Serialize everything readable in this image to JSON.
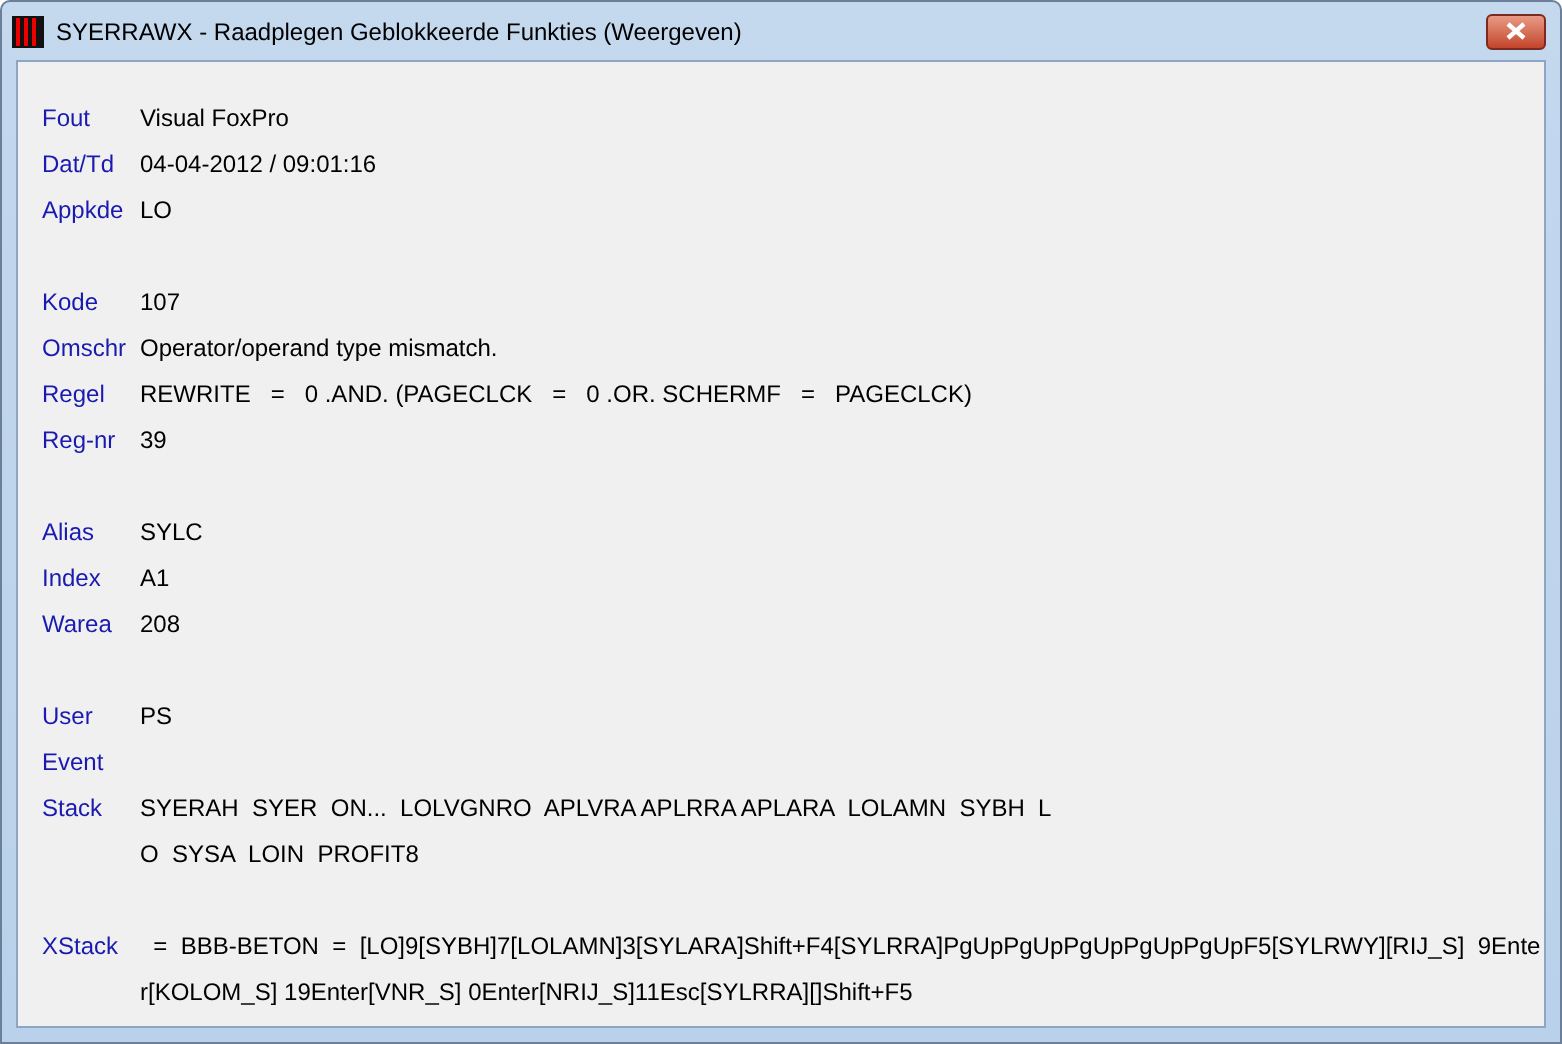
{
  "window": {
    "title": "SYERRAWX - Raadplegen Geblokkeerde Funkties (Weergeven)"
  },
  "groups": [
    {
      "fields": [
        {
          "label": "Fout",
          "lines": [
            "Visual FoxPro"
          ]
        },
        {
          "label": "Dat/Td",
          "lines": [
            "04-04-2012 / 09:01:16"
          ]
        },
        {
          "label": "Appkde",
          "lines": [
            "LO"
          ]
        }
      ]
    },
    {
      "fields": [
        {
          "label": "Kode",
          "lines": [
            "107"
          ]
        },
        {
          "label": "Omschr",
          "lines": [
            "Operator/operand type mismatch."
          ]
        },
        {
          "label": "Regel",
          "lines": [
            "REWRITE   =   0 .AND. (PAGECLCK   =   0 .OR. SCHERMF   =   PAGECLCK)"
          ]
        },
        {
          "label": "Reg-nr",
          "lines": [
            "39"
          ]
        }
      ]
    },
    {
      "fields": [
        {
          "label": "Alias",
          "lines": [
            "SYLC"
          ]
        },
        {
          "label": "Index",
          "lines": [
            "A1"
          ]
        },
        {
          "label": "Warea",
          "lines": [
            "208"
          ]
        }
      ]
    },
    {
      "fields": [
        {
          "label": "User",
          "lines": [
            "PS"
          ]
        },
        {
          "label": "Event"
        },
        {
          "label": "Stack",
          "lines": [
            "SYERAH  SYER  ON...  LOLVGNRO  APLVRA APLRRA APLARA  LOLAMN  SYBH  L",
            "O  SYSA  LOIN  PROFIT8"
          ]
        }
      ]
    },
    {
      "fields": [
        {
          "label": "XStack",
          "lines": [
            "  =  BBB-BETON  =  [LO]9[SYBH]7[LOLAMN]3[SYLARA]Shift+F4[SYLRRA]PgUpPgUpPgUpPgUpPgUpF5[SYLRWY][RIJ_S]  9Ente",
            "r[KOLOM_S] 19Enter[VNR_S] 0Enter[NRIJ_S]11Esc[SYLRRA][]Shift+F5"
          ]
        }
      ]
    }
  ]
}
